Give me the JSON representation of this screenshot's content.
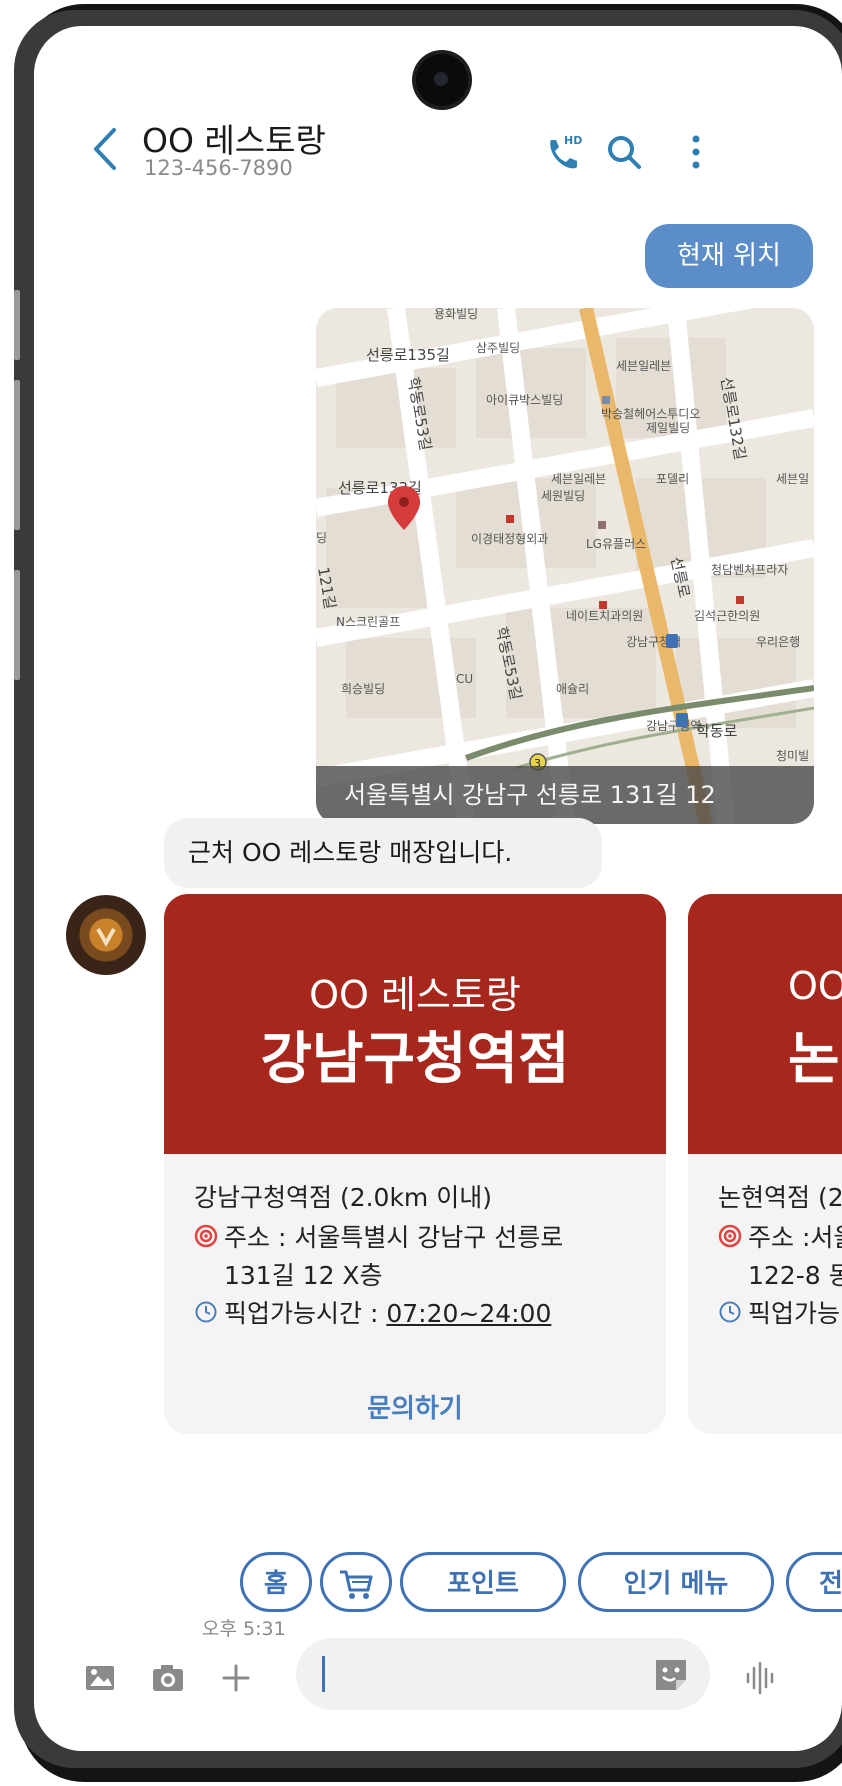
{
  "header": {
    "title": "OO 레스토랑",
    "phone": "123-456-7890"
  },
  "messages": {
    "outgoing_label": "현재 위치",
    "map_caption": "서울특별시 강남구 선릉로 131길 12",
    "bot_text": "근처 OO 레스토랑 매장입니다."
  },
  "map_labels": {
    "r1": "선릉로135길",
    "r2": "선릉로133길",
    "r3": "학동로53길",
    "r4": "학동로53길",
    "r5": "선릉로",
    "r6": "선릉로132길",
    "r7": "학동로",
    "p1": "용화빌딩",
    "p2": "삼주빌딩",
    "p3": "세븐일레븐",
    "p4": "아이큐박스빌딩",
    "p5": "박승철헤어스투디오",
    "p6": "제일빌딩",
    "p7": "세븐일레븐",
    "p8": "세원빌딩",
    "p9": "포델리",
    "p10": "세븐일",
    "p11": "이경태정형외과",
    "p12": "LG유플러스",
    "p13": "청담벤처프라자",
    "p14": "N스크린골프",
    "p15": "네이트치과의원",
    "p16": "김석근한의원",
    "p17": "강남구청역",
    "p18": "우리은행",
    "p19": "희승빌딩",
    "p20": "CU",
    "p21": "애슐리",
    "p22": "강남구청역",
    "p23": "청미빌",
    "p24": "3",
    "p25": "딩",
    "p26": "121길"
  },
  "cards": [
    {
      "brand": "OO 레스토랑",
      "store": "강남구청역점",
      "title_line": "강남구청역점 (2.0km 이내)",
      "address_line1": "주소 : 서울특별시 강남구 선릉로",
      "address_line2": "131길 12 X층",
      "hours_label": "픽업가능시간 :",
      "hours_value": "07:20~24:00",
      "action": "문의하기"
    },
    {
      "brand": "OO",
      "store": "논",
      "title_line": "논현역점 (2",
      "address_line1": "주소 :서울",
      "address_line2": "122-8 동",
      "hours_label": "픽업가능",
      "hours_value": ""
    }
  ],
  "chips": {
    "home": "홈",
    "point": "포인트",
    "popular": "인기 메뉴",
    "partial": "전"
  },
  "time": "오후 5:31",
  "colors": {
    "accent": "#3e72b5",
    "outgoing_bubble": "#5b8ec8",
    "card_header": "#a7271d"
  },
  "icons": [
    "back-arrow-icon",
    "hd-call-icon",
    "search-icon",
    "more-vert-icon",
    "image-icon",
    "camera-icon",
    "plus-icon",
    "sticker-icon",
    "voice-icon",
    "cart-icon",
    "target-icon",
    "clock-icon"
  ]
}
